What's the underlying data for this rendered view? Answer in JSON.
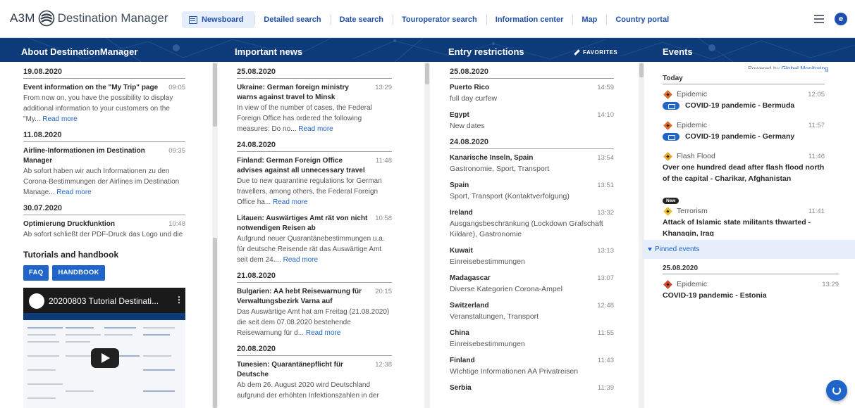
{
  "app": {
    "brand": "A3M",
    "title": "Destination Manager"
  },
  "nav": {
    "items": [
      "Newsboard",
      "Detailed search",
      "Date search",
      "Touroperator search",
      "Information center",
      "Map",
      "Country portal"
    ],
    "active_index": 0
  },
  "user": {
    "avatar_letter": "e"
  },
  "columns": {
    "about": "About DestinationManager",
    "news": "Important news",
    "entry": "Entry restrictions",
    "favorites": "FAVORITES",
    "events": "Events"
  },
  "about": {
    "groups": [
      {
        "date": "19.08.2020",
        "items": [
          {
            "title": "Event information on the \"My Trip\" page",
            "time": "09:05",
            "text": "From now on, you have the possibility to display additional information to your customers on the \"My...",
            "more": "Read more"
          }
        ]
      },
      {
        "date": "11.08.2020",
        "items": [
          {
            "title": "Airline-Informationen im Destination Manager",
            "time": "09:35",
            "text": "Ab sofort haben wir auch Informationen zu den Corona-Bestimmungen der Airlines im Destination Manage...",
            "more": "Read more"
          }
        ]
      },
      {
        "date": "30.07.2020",
        "items": [
          {
            "title": "Optimierung Druckfunktion",
            "time": "10:48",
            "text": "Ab sofort schließt der PDF-Druck das Logo und die",
            "more": ""
          }
        ]
      }
    ],
    "tutorials": {
      "title": "Tutorials and handbook",
      "faq": "FAQ",
      "handbook": "HANDBOOK",
      "video_title": "20200803 Tutorial Destinati..."
    }
  },
  "news": {
    "groups": [
      {
        "date": "25.08.2020",
        "items": [
          {
            "title": "Ukraine: German foreign ministry warns against travel to Minsk",
            "time": "13:29",
            "text": "In view of the number of cases, the Federal Foreign Office has ordered the following measures: Do no...",
            "more": "Read more"
          }
        ]
      },
      {
        "date": "24.08.2020",
        "items": [
          {
            "title": "Finland: German Foreign Office advises against all unnecessary travel",
            "time": "11:48",
            "text": "Due to new quarantine regulations for German travellers, among others, the Federal Foreign Office ha...",
            "more": "Read more"
          },
          {
            "title": "Litauen: Auswärtiges Amt rät von nicht notwendigen Reisen ab",
            "time": "10:58",
            "text": "Aufgrund neuer Quarantänebestimmungen u.a. für deutsche Reisende rät das Auswärtige Amt seit dem 24....",
            "more": "Read more"
          }
        ]
      },
      {
        "date": "21.08.2020",
        "items": [
          {
            "title": "Bulgarien: AA hebt Reisewarnung für Verwaltungsbezirk Varna auf",
            "time": "20:15",
            "text": "Das Auswärtige Amt hat am Freitag (21.08.2020) die seit dem 07.08.2020 bestehende Reisewarnung für d...",
            "more": "Read more"
          }
        ]
      },
      {
        "date": "20.08.2020",
        "items": [
          {
            "title": "Tunesien: Quarantänepflicht für Deutsche",
            "time": "12:38",
            "text": "Ab dem 26. August 2020 wird Deutschland aufgrund der erhöhten Infektionszahlen in der",
            "more": ""
          }
        ]
      }
    ]
  },
  "entry": {
    "groups": [
      {
        "date": "25.08.2020",
        "items": [
          {
            "title": "Puerto Rico",
            "time": "14:59",
            "text": "full day curfew"
          },
          {
            "title": "Egypt",
            "time": "14:10",
            "text": "New dates"
          }
        ]
      },
      {
        "date": "24.08.2020",
        "items": [
          {
            "title": "Kanarische Inseln, Spain",
            "time": "13:54",
            "text": "Gastronomie, Sport, Transport"
          },
          {
            "title": "Spain",
            "time": "13:51",
            "text": "Sport, Transport (Kontaktverfolgung)"
          },
          {
            "title": "Ireland",
            "time": "13:32",
            "text": "Ausgangsbeschränkung (Lockdown Grafschaft Kildare), Gastronomie"
          },
          {
            "title": "Kuwait",
            "time": "13:13",
            "text": "Einreisebestimmungen"
          },
          {
            "title": "Madagascar",
            "time": "13:07",
            "text": "Diverse Kategorien Corona-Ampel"
          },
          {
            "title": "Switzerland",
            "time": "12:48",
            "text": "Veranstaltungen, Transport"
          },
          {
            "title": "China",
            "time": "11:55",
            "text": "Einreisebestimmungen"
          },
          {
            "title": "Finland",
            "time": "11:43",
            "text": "WIchtige Informationen AA Privatreisen"
          },
          {
            "title": "Serbia",
            "time": "11:39",
            "text": ""
          }
        ]
      }
    ]
  },
  "events": {
    "powered_by": "Powered by",
    "powered_link": "Global Monitoring",
    "today_label": "Today",
    "items": [
      {
        "category": "Epidemic",
        "time": "12:05",
        "title": "COVID-19 pandemic - Bermuda",
        "color": "#e06b2a",
        "has_mail": true,
        "is_new": false
      },
      {
        "category": "Epidemic",
        "time": "11:57",
        "title": "COVID-19 pandemic - Germany",
        "color": "#e06b2a",
        "has_mail": true,
        "is_new": false
      },
      {
        "category": "Flash Flood",
        "time": "11:46",
        "title": "Over one hundred dead after flash flood north of the capital - Charikar, Afghanistan",
        "color": "#e8a52a",
        "has_mail": false,
        "is_new": false
      },
      {
        "category": "Terrorism",
        "time": "11:41",
        "title": "Attack of Islamic state militants thwarted - Khanaqin, Iraq",
        "color": "#e8c22a",
        "has_mail": false,
        "is_new": true,
        "badge": "New"
      }
    ],
    "pinned_label": "Pinned events",
    "pinned": {
      "date": "25.08.2020",
      "category": "Epidemic",
      "time": "13:29",
      "title": "COVID-19 pandemic - Estonia",
      "color": "#d9472b"
    }
  },
  "colors": {
    "brand": "#0d3b7a",
    "accent": "#1f64c8"
  }
}
